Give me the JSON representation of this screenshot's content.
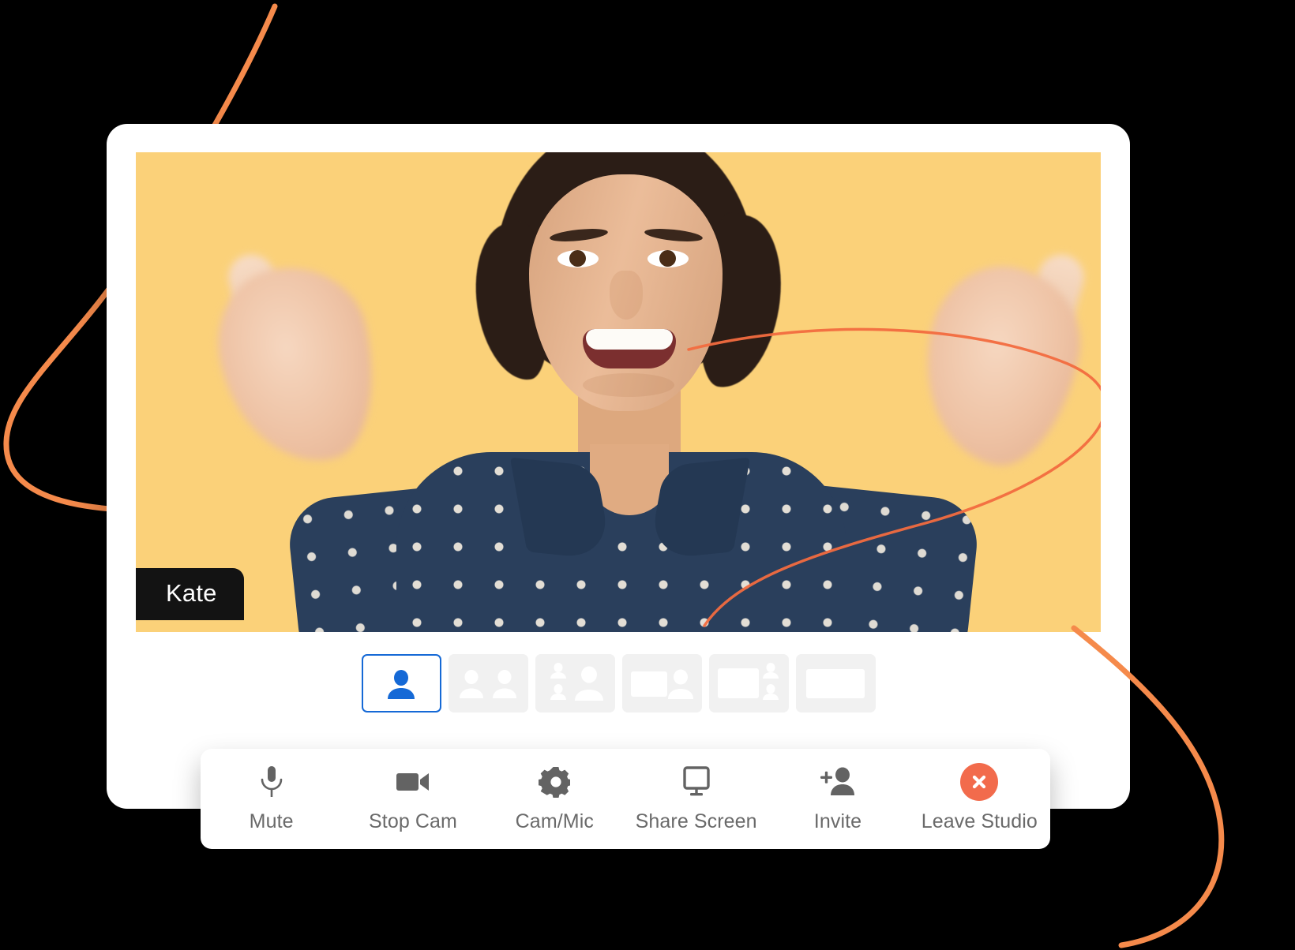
{
  "app": {
    "background_color": "#000000",
    "card_color": "#ffffff",
    "accent_blue": "#1569d6",
    "accent_orange": "#F58A4B",
    "leave_color": "#F26B4C",
    "video_background": "#FBD179"
  },
  "video": {
    "participant_name": "Kate",
    "name_badge_bg": "#131313",
    "name_badge_text_color": "#ffffff"
  },
  "layouts": {
    "selected_index": 0,
    "items": [
      {
        "id": "layout-solo",
        "icon": "single-speaker-icon",
        "selected": true,
        "label": "Solo"
      },
      {
        "id": "layout-side-by-side",
        "icon": "two-people-icon",
        "selected": false,
        "label": "Side by side"
      },
      {
        "id": "layout-stacked",
        "icon": "stacked-people-icon",
        "selected": false,
        "label": "Stacked"
      },
      {
        "id": "layout-screen-left",
        "icon": "screen-and-person-icon",
        "selected": false,
        "label": "Screen + person"
      },
      {
        "id": "layout-screen-strip",
        "icon": "screen-and-strip-icon",
        "selected": false,
        "label": "Screen + strip"
      },
      {
        "id": "layout-screen-only",
        "icon": "screen-only-icon",
        "selected": false,
        "label": "Screen only"
      }
    ]
  },
  "controls": [
    {
      "id": "mute",
      "label": "Mute",
      "icon": "microphone-icon"
    },
    {
      "id": "stop-cam",
      "label": "Stop Cam",
      "icon": "video-camera-icon"
    },
    {
      "id": "cam-mic",
      "label": "Cam/Mic",
      "icon": "gear-icon"
    },
    {
      "id": "share-screen",
      "label": "Share Screen",
      "icon": "monitor-icon"
    },
    {
      "id": "invite",
      "label": "Invite",
      "icon": "add-person-icon"
    },
    {
      "id": "leave-studio",
      "label": "Leave Studio",
      "icon": "close-circle-icon"
    }
  ]
}
